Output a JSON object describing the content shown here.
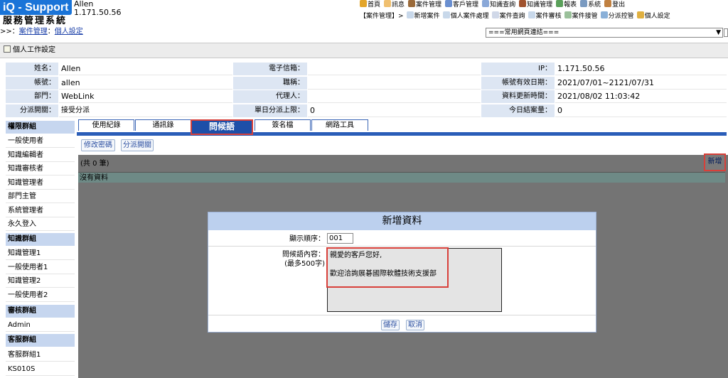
{
  "header": {
    "logo_text": "iQ - Support",
    "system_name": "服務管理系統",
    "user_name": "Allen",
    "user_ip": "1.171.50.56",
    "breadcrumb_prefix": ">>：",
    "breadcrumb_link": "案件管理",
    "breadcrumb_sep": "：",
    "breadcrumb_current": "個人設定",
    "quick_links_selected": "===常用網頁連結===",
    "top_nav": [
      "首頁",
      "訊息",
      "案件管理",
      "客戶管理",
      "知識查詢",
      "知識管理",
      "報表",
      "系統",
      "登出"
    ],
    "sub_nav_prefix": "【案件管理】>",
    "sub_nav": [
      "新增案件",
      "個人案件處理",
      "案件查詢",
      "案件審核",
      "案件接管",
      "分派控管",
      "個人設定"
    ]
  },
  "page_title": "個人工作設定",
  "profile": {
    "name_label": "姓名：",
    "name_value": "Allen",
    "email_label": "電子信箱：",
    "email_value": "",
    "ip_label": "IP：",
    "ip_value": "1.171.50.56",
    "account_label": "帳號：",
    "account_value": "allen",
    "title_label": "職稱：",
    "title_value": "",
    "validity_label": "帳號有效日期：",
    "validity_value": "2021/07/01~2121/07/31",
    "dept_label": "部門：",
    "dept_value": "WebLink",
    "agent_label": "代理人：",
    "agent_value": "",
    "updated_label": "資料更新時間：",
    "updated_value": "2021/08/02 11:03:42",
    "dispatch_label": "分派開關：",
    "dispatch_value": "接受分派",
    "daily_limit_label": "單日分派上限：",
    "daily_limit_value": "0",
    "today_count_label": "今日結案量：",
    "today_count_value": "0"
  },
  "sidebar": {
    "groups": [
      {
        "title": "權限群組",
        "items": [
          "一般使用者",
          "知識編輯者",
          "知識審核者",
          "知識管理者",
          "部門主管",
          "系統管理者",
          "永久登入"
        ]
      },
      {
        "title": "知識群組",
        "items": [
          "知識管理1",
          "一般使用者1",
          "知識管理2",
          "一般使用者2"
        ]
      },
      {
        "title": "審核群組",
        "items": [
          "Admin"
        ]
      },
      {
        "title": "客服群組",
        "items": [
          "客服群組1",
          "KS010S"
        ]
      }
    ]
  },
  "tabs": [
    "使用紀錄",
    "通訊錄",
    "問候語",
    "簽名檔",
    "網路工具"
  ],
  "buttons": {
    "change_password": "修改密碼",
    "dispatch_toggle": "分派開關",
    "add_new": "新增"
  },
  "list": {
    "count_text": "(共 0 筆)",
    "empty_text": "沒有資料"
  },
  "dialog": {
    "title": "新增資料",
    "order_label": "顯示順序：",
    "order_value": "001",
    "content_label": "問候語內容：",
    "content_hint": "(最多500字)",
    "content_value": "親愛的客戶您好,\n\n歡迎洽詢展碁國際軟體技術支援部",
    "save_label": "儲存",
    "cancel_label": "取消"
  },
  "colors": {
    "brand": "#1a74d8",
    "tab_active": "#1e4fa8",
    "highlight": "#d8403a",
    "label_bg": "#dde6f3",
    "group_header_bg": "#c6d6ef"
  }
}
